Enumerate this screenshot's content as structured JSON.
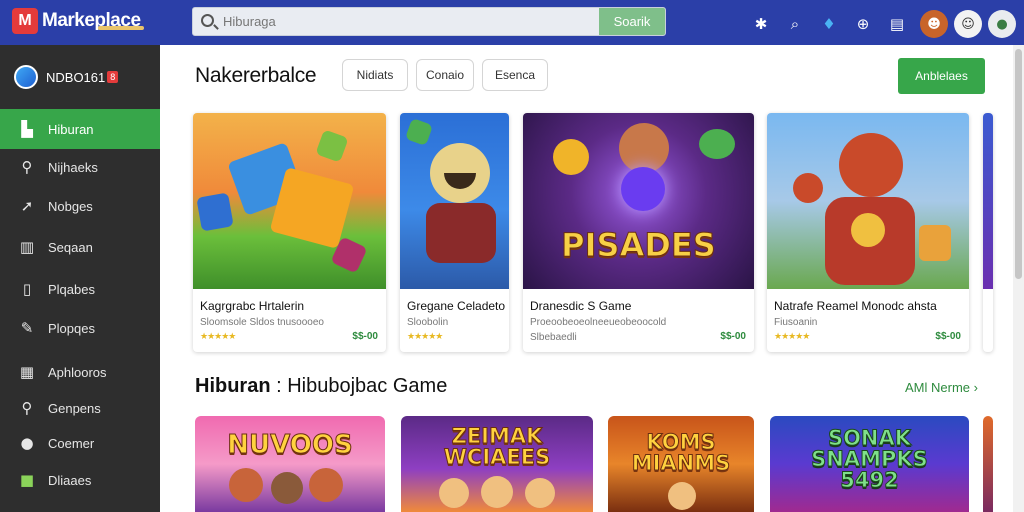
{
  "header": {
    "brand_logo_glyph": "M",
    "brand_name": "Markeplace",
    "search": {
      "value": "Hiburaga",
      "button_label": "Soarik"
    },
    "icons": [
      "settings-icon",
      "search-icon",
      "twitter-icon",
      "globe-icon",
      "document-icon"
    ],
    "avatars": [
      "monkey-avatar",
      "person-avatar",
      "user-avatar"
    ]
  },
  "sidebar": {
    "account_name": "NDBO161",
    "account_badge": "8",
    "items": [
      {
        "label": "Hiburan",
        "icon": "entertainment-icon",
        "active": true
      },
      {
        "label": "Nijhaeks",
        "icon": "search-icon",
        "active": false
      },
      {
        "label": "Nobges",
        "icon": "pin-icon",
        "active": false
      },
      {
        "label": "Seqaan",
        "icon": "chart-icon",
        "active": false
      },
      {
        "label": "Plqabes",
        "icon": "document-icon",
        "active": false
      },
      {
        "label": "Plopqes",
        "icon": "edit-icon",
        "active": false
      },
      {
        "label": "Aphlooros",
        "icon": "apps-icon",
        "active": false
      },
      {
        "label": "Genpens",
        "icon": "location-icon",
        "active": false
      },
      {
        "label": "Coemer",
        "icon": "circle-icon",
        "active": false
      },
      {
        "label": "Dliaaes",
        "icon": "box-icon",
        "active": false
      }
    ]
  },
  "main": {
    "title": "Nakererbalce",
    "filters": [
      "Nidiats",
      "Conaio",
      "Esenca"
    ],
    "primary_button": "Anblelaes",
    "featured": [
      {
        "title": "Kagrgrabc Hrtalerin",
        "subtitle": "Sloomsole Sldos  tnusoooeo",
        "rating": "★★★★★",
        "price": "$$-00"
      },
      {
        "title": "Gregane Celadeto",
        "subtitle": "Sloobolin",
        "rating": "★★★★★",
        "price": ""
      },
      {
        "title": "Dranesdic S Game",
        "subtitle": "Proeoobeoeolneeueobeoocold",
        "subtitle2": "Slbebaedli",
        "rating": "★★★★★",
        "price": "$$-00",
        "art_text": "PISADES"
      },
      {
        "title": "Natrafe Reamel Monodc ahsta",
        "subtitle": "Fiusoanin",
        "rating": "★★★★★",
        "price": "$$-00"
      }
    ],
    "section": {
      "title_bold": "Hiburan",
      "title_rest": ": Hibubojbac Game",
      "more_label": "AMl Nerme ›"
    },
    "games": [
      {
        "art_text": "NUVOOS"
      },
      {
        "art_text": "ZEIMAK WCIAEES"
      },
      {
        "art_text": "KOMS MIANMS"
      },
      {
        "art_text": "SONAK SNAMPKS 5492"
      }
    ]
  }
}
